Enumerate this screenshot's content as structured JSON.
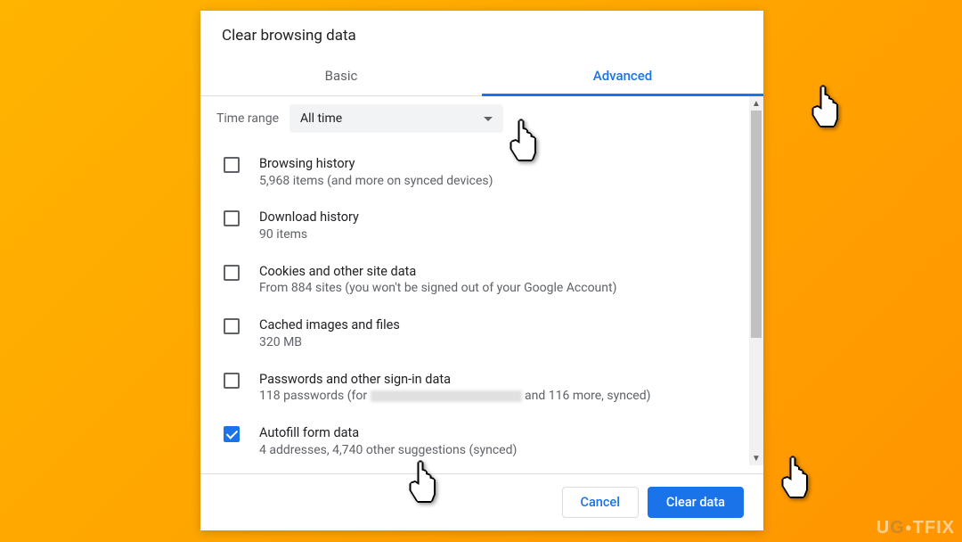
{
  "dialog": {
    "title": "Clear browsing data",
    "tabs": {
      "basic": "Basic",
      "advanced": "Advanced",
      "active": "advanced"
    },
    "timeRange": {
      "label": "Time range",
      "value": "All time"
    },
    "items": [
      {
        "title": "Browsing history",
        "sub_pre": "5,968 items (and more on synced devices)",
        "sub_post": "",
        "checked": false,
        "redacted": false
      },
      {
        "title": "Download history",
        "sub_pre": "90 items",
        "sub_post": "",
        "checked": false,
        "redacted": false
      },
      {
        "title": "Cookies and other site data",
        "sub_pre": "From 884 sites (you won't be signed out of your Google Account)",
        "sub_post": "",
        "checked": false,
        "redacted": false
      },
      {
        "title": "Cached images and files",
        "sub_pre": "320 MB",
        "sub_post": "",
        "checked": false,
        "redacted": false
      },
      {
        "title": "Passwords and other sign-in data",
        "sub_pre": "118 passwords (for ",
        "sub_post": " and 116 more, synced)",
        "checked": false,
        "redacted": true
      },
      {
        "title": "Autofill form data",
        "sub_pre": "4 addresses, 4,740 other suggestions (synced)",
        "sub_post": "",
        "checked": true,
        "redacted": false
      }
    ],
    "buttons": {
      "cancel": "Cancel",
      "clear": "Clear data"
    }
  },
  "watermark": {
    "pre": "U",
    "mid": "G",
    "post": "TFIX"
  },
  "colors": {
    "accent": "#1a73e8"
  }
}
